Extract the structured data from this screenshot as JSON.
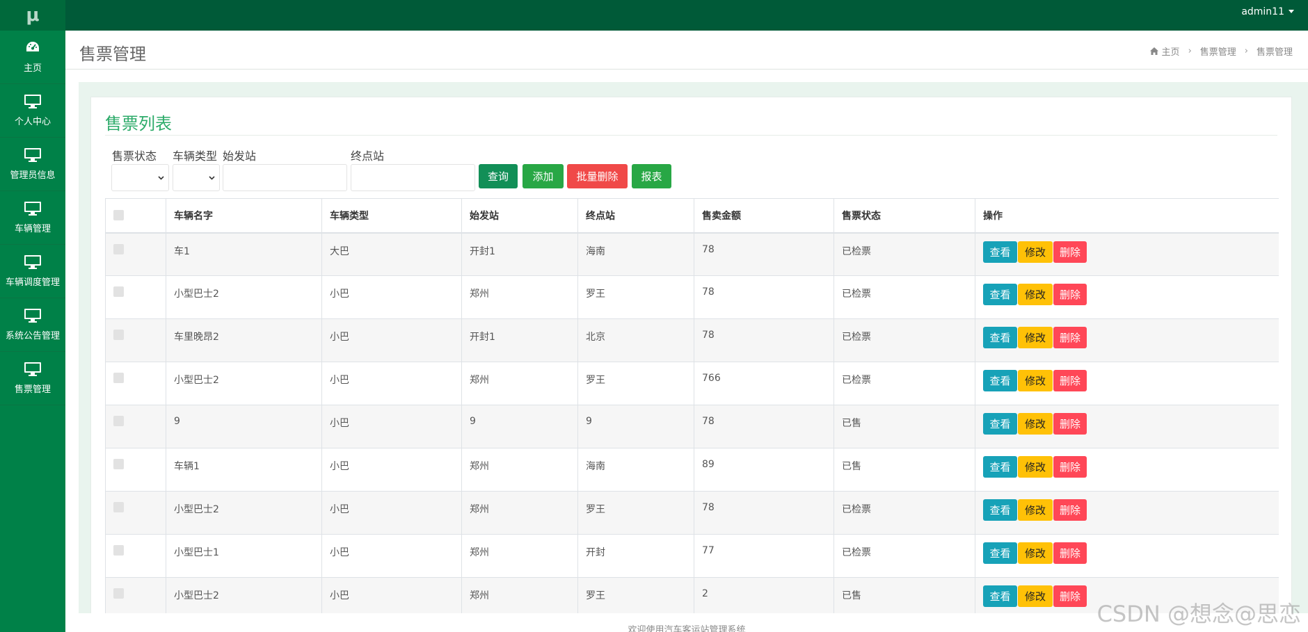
{
  "logo": "μ",
  "user": "admin11",
  "sidebar": {
    "items": [
      {
        "label": "主页",
        "icon": "dashboard-icon"
      },
      {
        "label": "个人中心",
        "icon": "monitor-icon"
      },
      {
        "label": "管理员信息",
        "icon": "monitor-icon"
      },
      {
        "label": "车辆管理",
        "icon": "monitor-icon"
      },
      {
        "label": "车辆调度管理",
        "icon": "monitor-icon"
      },
      {
        "label": "系统公告管理",
        "icon": "monitor-icon"
      },
      {
        "label": "售票管理",
        "icon": "monitor-icon"
      }
    ]
  },
  "header": {
    "title": "售票管理",
    "breadcrumb": [
      "主页",
      "售票管理",
      "售票管理"
    ]
  },
  "card": {
    "title": "售票列表"
  },
  "filters": {
    "status_label": "售票状态",
    "type_label": "车辆类型",
    "start_label": "始发站",
    "end_label": "终点站",
    "query": "查询",
    "add": "添加",
    "batch_delete": "批量删除",
    "report": "报表"
  },
  "table": {
    "columns": [
      "车辆名字",
      "车辆类型",
      "始发站",
      "终点站",
      "售卖金额",
      "售票状态",
      "操作"
    ],
    "actions": {
      "view": "查看",
      "edit": "修改",
      "delete": "删除"
    },
    "rows": [
      [
        "车1",
        "大巴",
        "开封1",
        "海南",
        "78",
        "已检票"
      ],
      [
        "小型巴士2",
        "小巴",
        "郑州",
        "罗王",
        "78",
        "已检票"
      ],
      [
        "车里晚昂2",
        "小巴",
        "开封1",
        "北京",
        "78",
        "已检票"
      ],
      [
        "小型巴士2",
        "小巴",
        "郑州",
        "罗王",
        "766",
        "已检票"
      ],
      [
        "9",
        "小巴",
        "9",
        "9",
        "78",
        "已售"
      ],
      [
        "车辆1",
        "小巴",
        "郑州",
        "海南",
        "89",
        "已售"
      ],
      [
        "小型巴士2",
        "小巴",
        "郑州",
        "罗王",
        "78",
        "已检票"
      ],
      [
        "小型巴士1",
        "小巴",
        "郑州",
        "开封",
        "77",
        "已检票"
      ],
      [
        "小型巴士2",
        "小巴",
        "郑州",
        "罗王",
        "2",
        "已售"
      ]
    ]
  },
  "footer": "欢迎使用汽车客运站管理系统",
  "watermark": "CSDN @想念@思恋"
}
